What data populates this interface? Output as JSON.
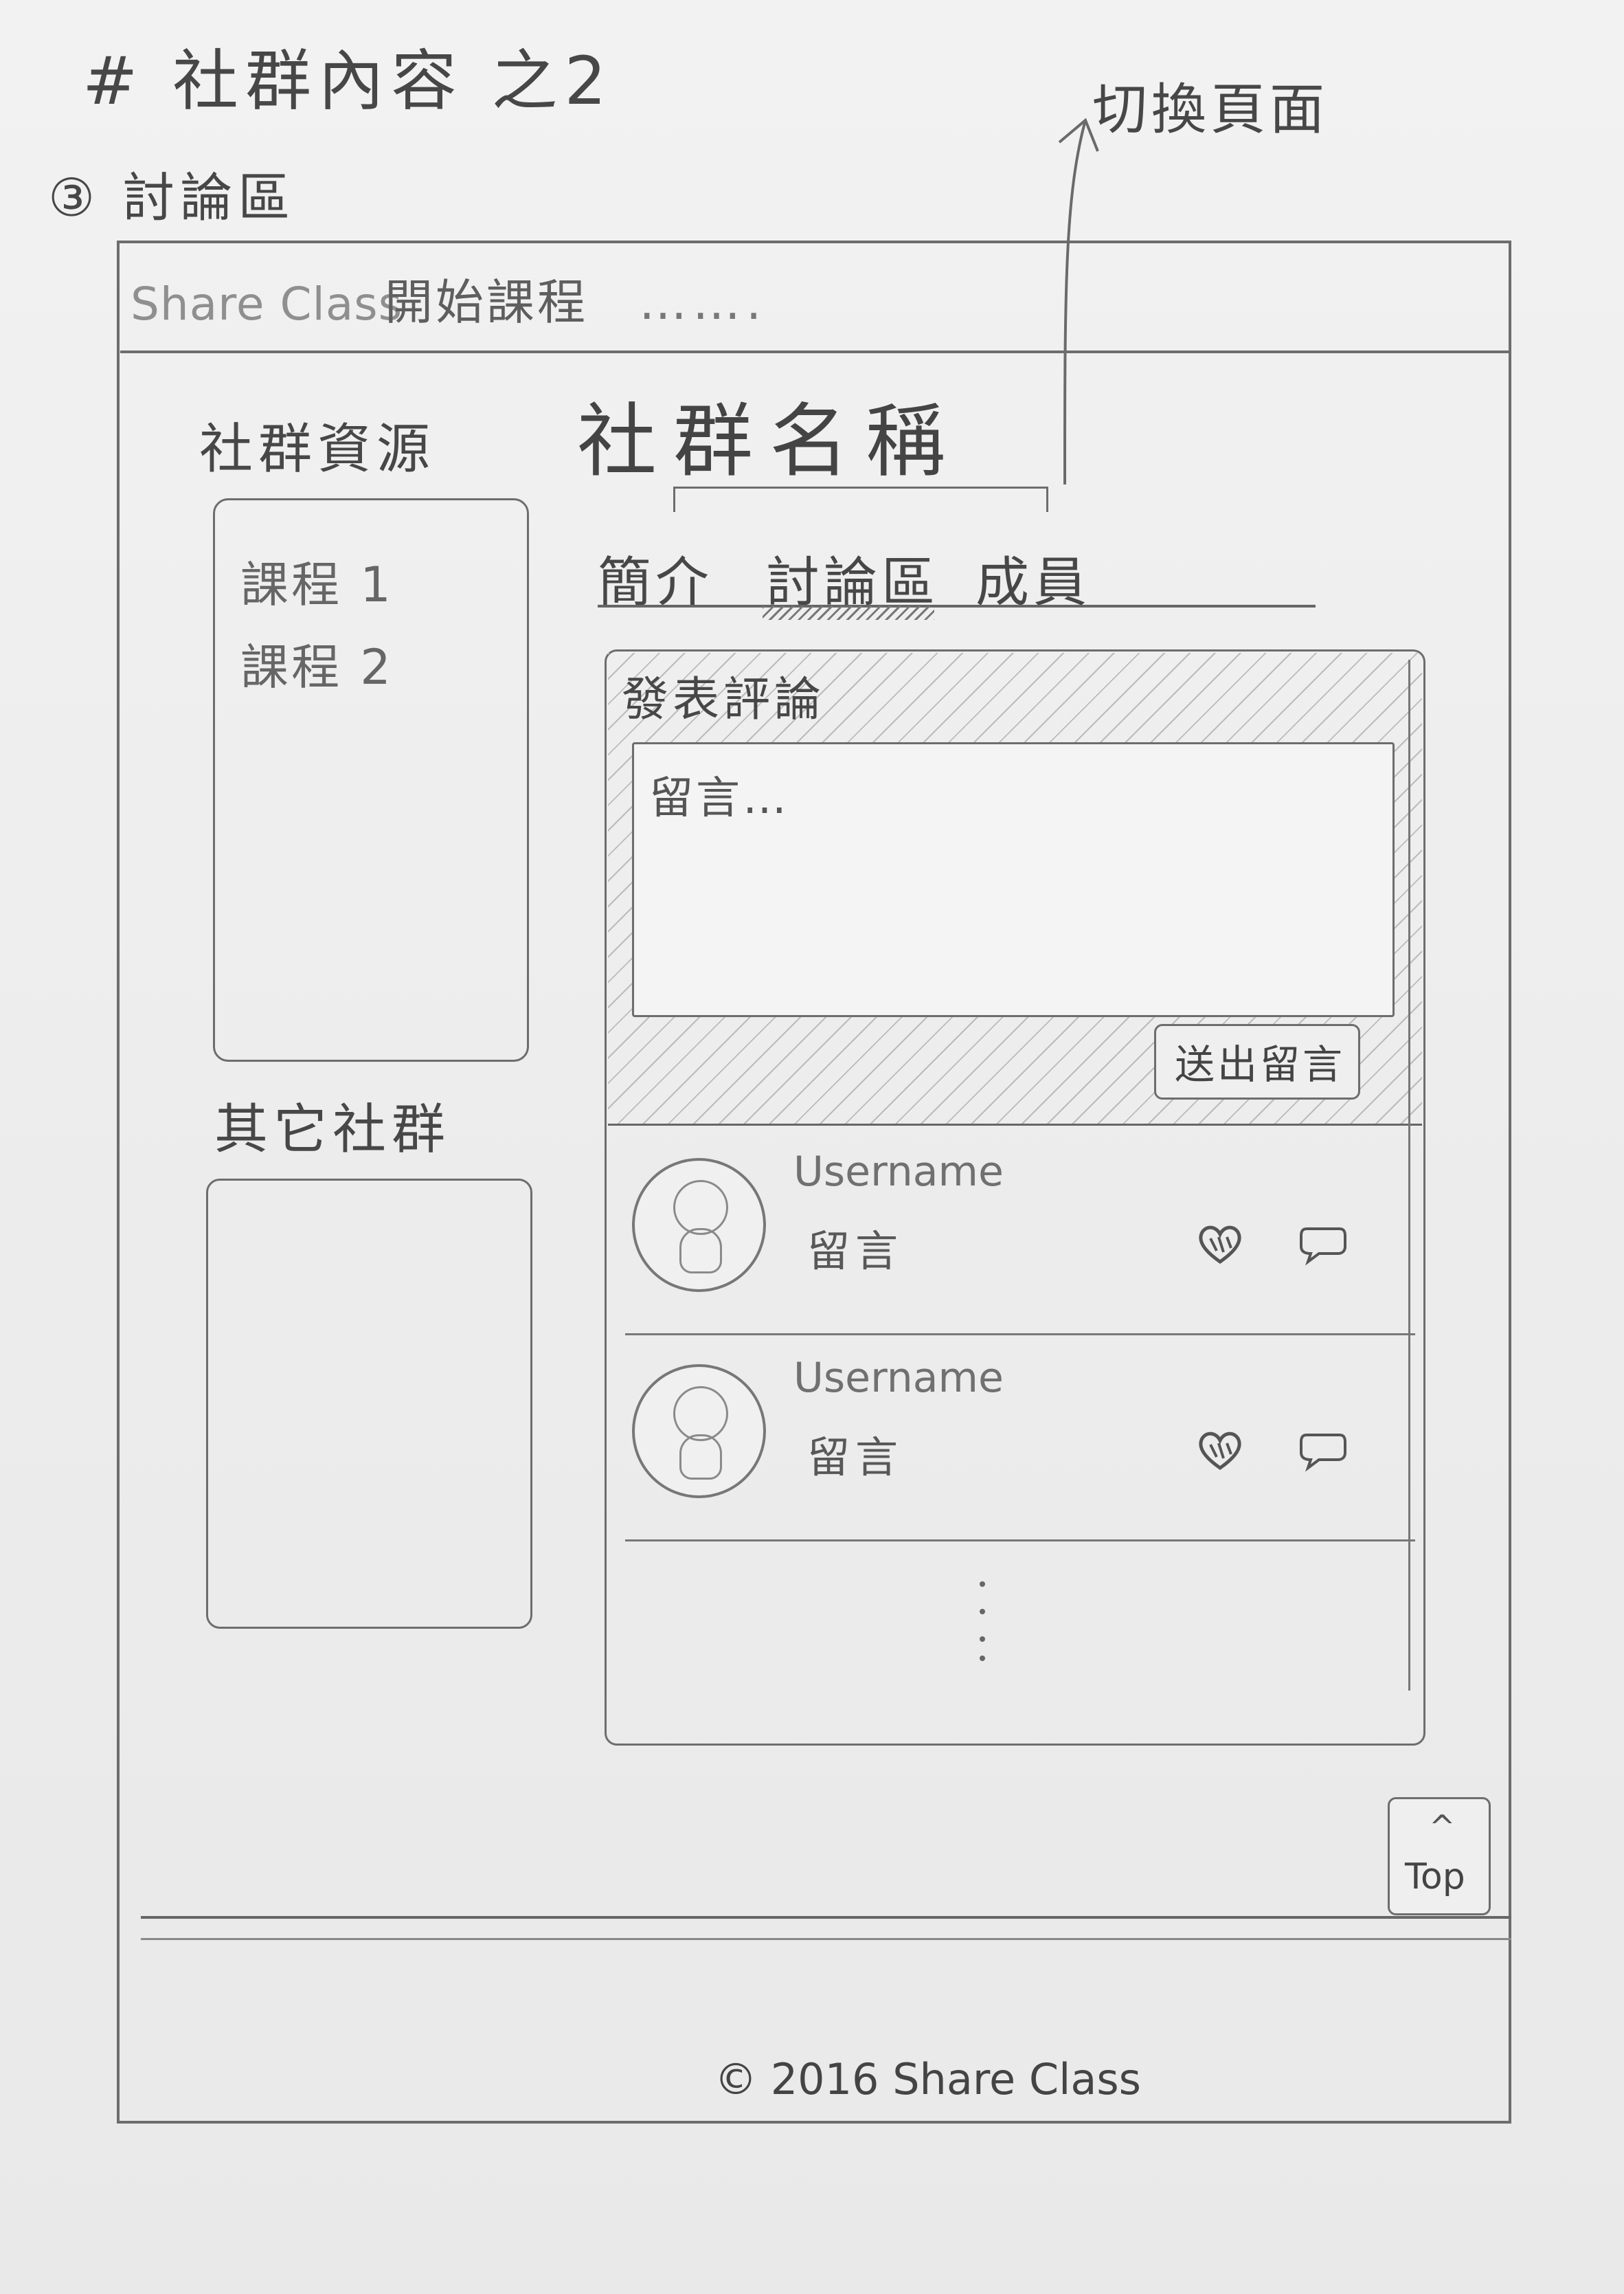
{
  "notes": {
    "title": "# 社群內容 之2",
    "section": "③ 討論區",
    "switch_note": "切換頁面"
  },
  "header": {
    "brand": "Share Class",
    "start_course": "開始課程",
    "more": "……."
  },
  "left_panel": {
    "resources_title": "社群資源",
    "courses": [
      "課程 1",
      "課程 2"
    ],
    "other_communities_title": "其它社群"
  },
  "main": {
    "community_name": "社群名稱",
    "tabs": [
      "簡介",
      "討論區",
      "成員"
    ],
    "active_tab": "討論區",
    "post": {
      "title": "發表評論",
      "placeholder": "留言…",
      "send_label": "送出留言"
    },
    "comments": [
      {
        "username": "Username",
        "text": "留言"
      },
      {
        "username": "Username",
        "text": "留言"
      }
    ]
  },
  "footer": {
    "top_arrow": "^",
    "top_label": "Top",
    "copyright": "© 2016 Share Class"
  },
  "icons": {
    "avatar": "avatar-icon",
    "like": "heart-icon",
    "reply": "speech-bubble-icon"
  }
}
